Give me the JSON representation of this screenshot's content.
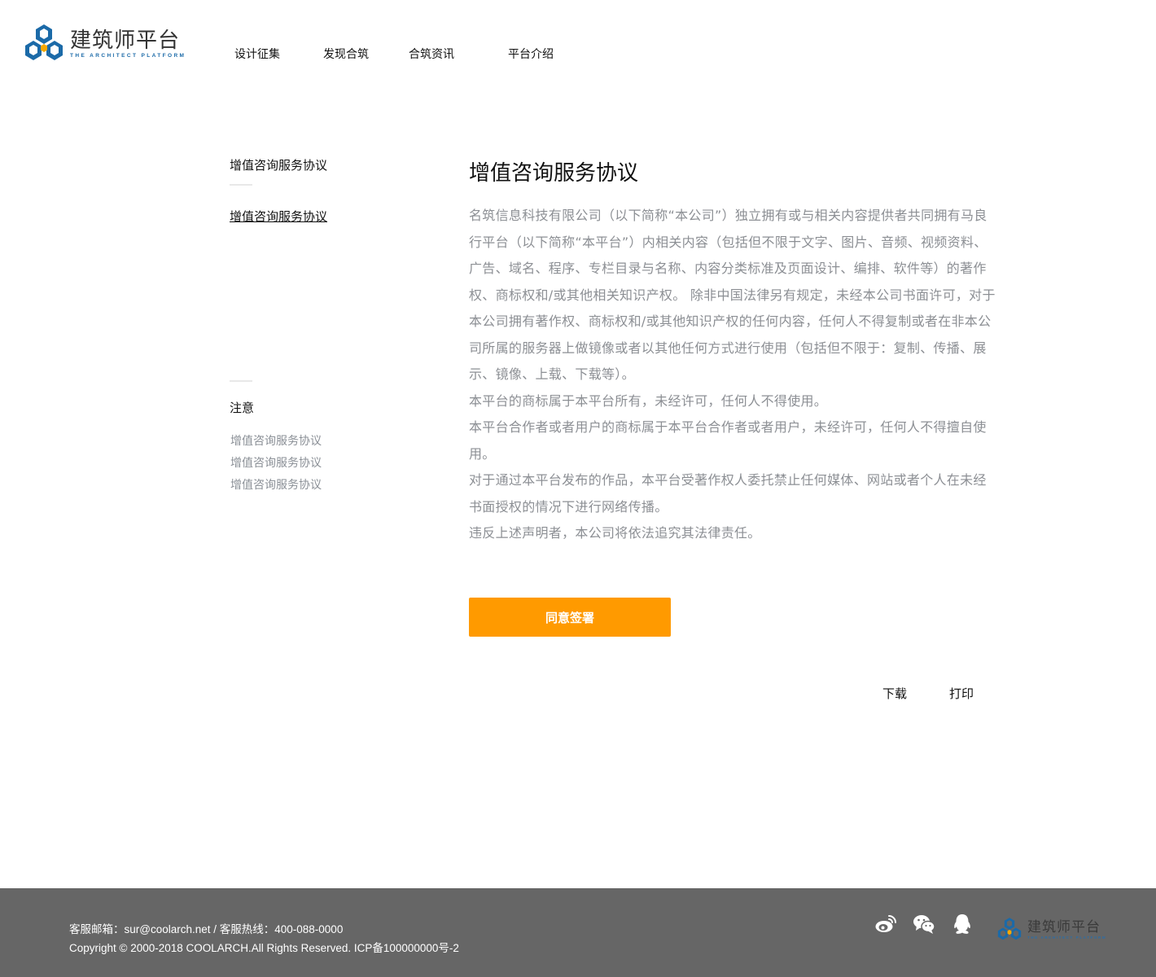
{
  "brand": {
    "name_cn": "建筑师平台",
    "name_en": "THE ARCHITECT PLATFORM",
    "color_blue": "#1b6aa8",
    "color_orange": "#ff9a00"
  },
  "nav": {
    "items": [
      {
        "label": "设计征集"
      },
      {
        "label": "发现合筑"
      },
      {
        "label": "合筑资讯"
      },
      {
        "label": "平台介绍"
      }
    ]
  },
  "sidebar": {
    "title": "增值咨询服务协议",
    "active_link": "增值咨询服务协议",
    "note_title": "注意",
    "sub_links": [
      "增值咨询服务协议",
      "增值咨询服务协议",
      "增值咨询服务协议"
    ]
  },
  "main": {
    "title": "增值咨询服务协议",
    "paragraphs": [
      "名筑信息科技有限公司（以下简称“本公司”）独立拥有或与相关内容提供者共同拥有马良行平台（以下简称“本平台”）内相关内容（包括但不限于文字、图片、音频、视频资料、广告、域名、程序、专栏目录与名称、内容分类标准及页面设计、编排、软件等）的著作权、商标权和/或其他相关知识产权。 除非中国法律另有规定，未经本公司书面许可，对于本公司拥有著作权、商标权和/或其他知识产权的任何内容，任何人不得复制或者在非本公司所属的服务器上做镜像或者以其他任何方式进行使用（包括但不限于：复制、传播、展示、镜像、上载、下载等）。",
      "本平台的商标属于本平台所有，未经许可，任何人不得使用。",
      "本平台合作者或者用户的商标属于本平台合作者或者用户，未经许可，任何人不得擅自使用。",
      "对于通过本平台发布的作品，本平台受著作权人委托禁止任何媒体、网站或者个人在未经书面授权的情况下进行网络传播。",
      "违反上述声明者，本公司将依法追究其法律责任。"
    ],
    "agree_button": "同意签署",
    "download_label": "下载",
    "print_label": "打印"
  },
  "footer": {
    "contact": "客服邮箱：sur@coolarch.net / 客服热线：400-088-0000",
    "copyright": "Copyright © 2000-2018 COOLARCH.All Rights Reserved.  ICP备100000000号-2",
    "icons": [
      "weibo-icon",
      "wechat-icon",
      "qq-icon"
    ],
    "background": "#666666"
  }
}
